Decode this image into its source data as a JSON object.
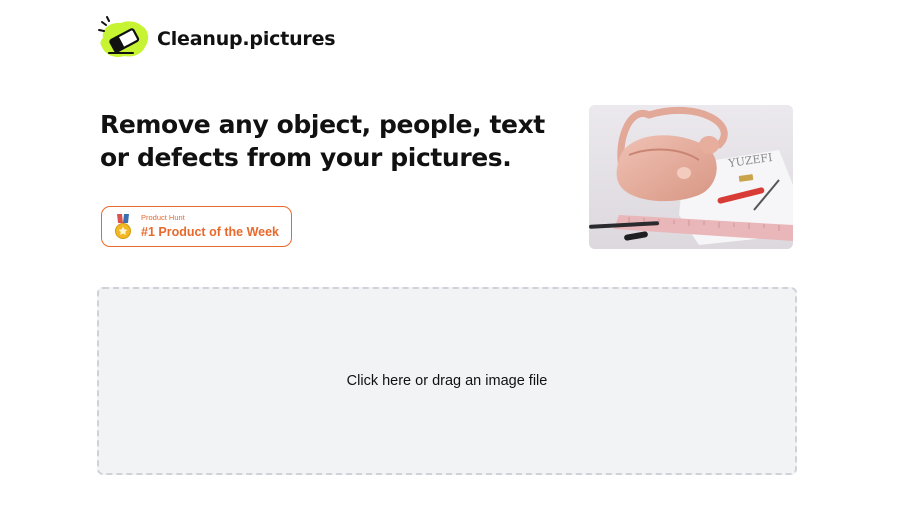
{
  "brand": {
    "name": "Cleanup.pictures",
    "logo_icon": "eraser-icon",
    "logo_color": "#c6f432"
  },
  "hero": {
    "title": "Remove any object, people, text or defects from your pictures."
  },
  "product_hunt": {
    "small_label": "Product Hunt",
    "big_label": "#1 Product of the Week",
    "icon": "medal-icon",
    "accent": "#e9692c"
  },
  "hero_image": {
    "icon": "example-photo-bag"
  },
  "dropzone": {
    "label": "Click here or drag an image file"
  }
}
